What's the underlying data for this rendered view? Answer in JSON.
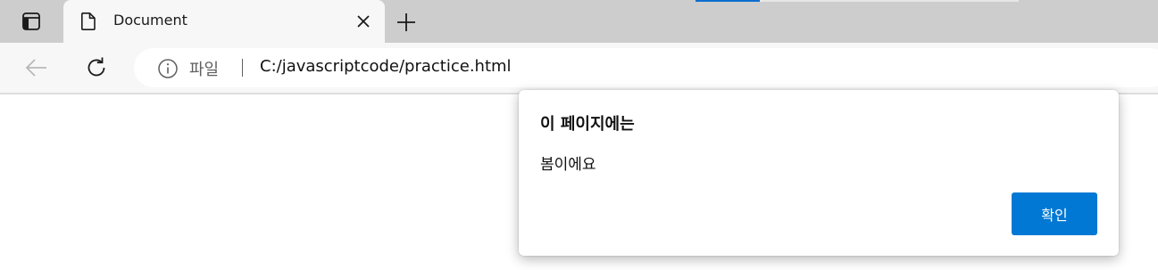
{
  "browser": {
    "tab": {
      "title": "Document"
    },
    "address_bar": {
      "site_label": "파일",
      "url": "C:/javascriptcode/practice.html"
    },
    "icons": {
      "tab_actions": "tab-actions-icon",
      "page": "document-icon",
      "close": "close-icon",
      "new_tab": "plus-icon",
      "back": "back-arrow-icon",
      "reload": "reload-icon",
      "info": "info-icon"
    }
  },
  "dialog": {
    "title": "이 페이지에는",
    "message": "봄이에요",
    "ok_label": "확인"
  },
  "colors": {
    "accent": "#0078d4",
    "tabbar": "#cdcdcd",
    "toolbar": "#f7f7f7",
    "loading": "#0b6fce"
  }
}
